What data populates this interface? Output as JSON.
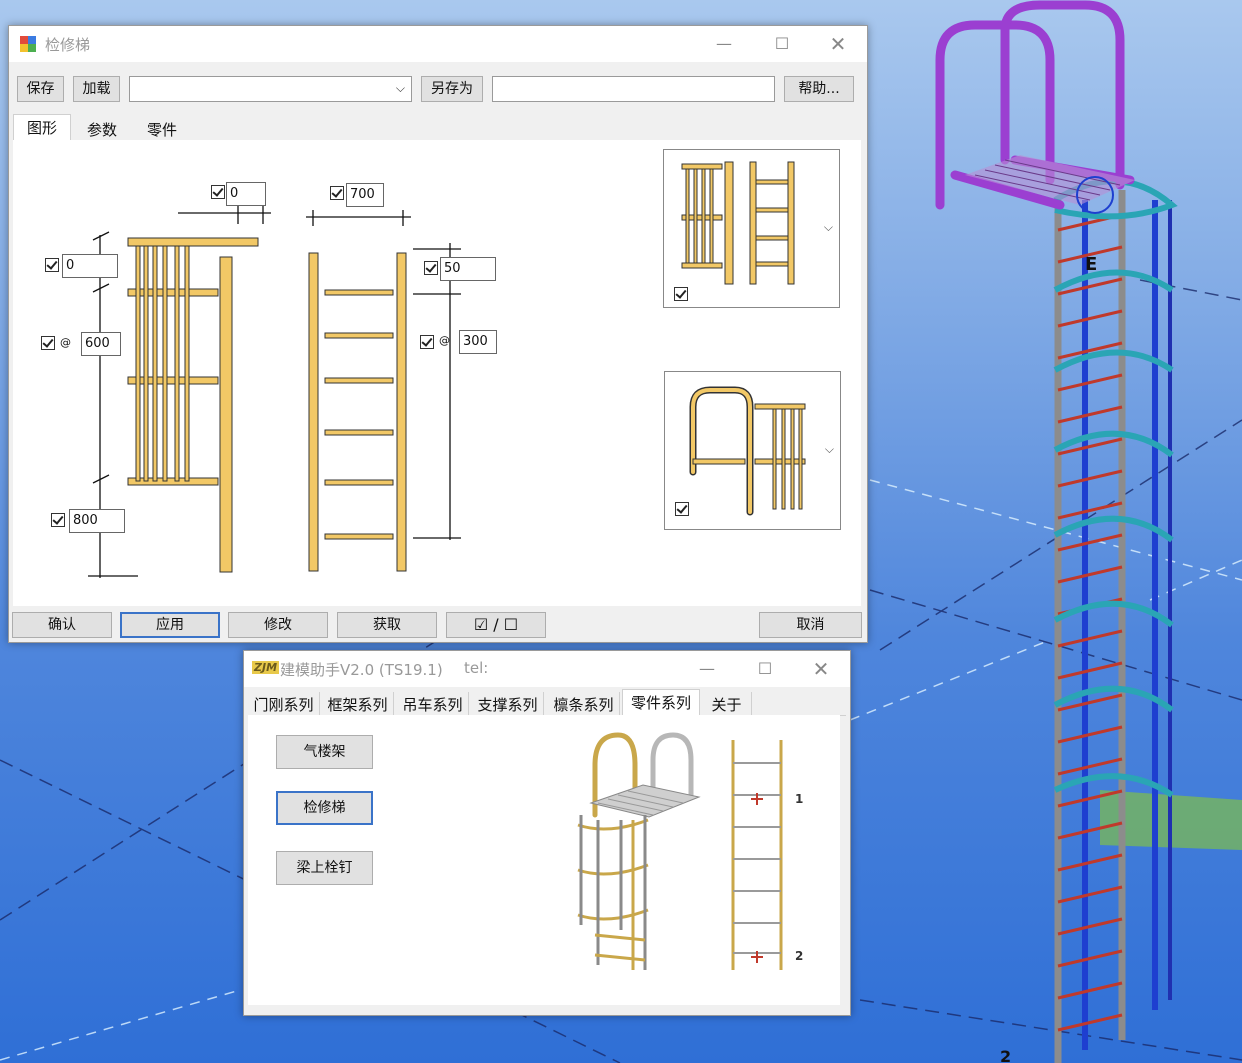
{
  "main_window": {
    "title": "检修梯",
    "toolbar": {
      "save": "保存",
      "load": "加载",
      "preset_value": "",
      "save_as": "另存为",
      "save_as_value": "",
      "help": "帮助..."
    },
    "tabs": [
      "图形",
      "参数",
      "零件"
    ],
    "active_tab": "图形",
    "dims": {
      "top_left": "0",
      "width": "700",
      "left_offset": "0",
      "spacing": "600",
      "bottom": "800",
      "right_offset": "50",
      "rung_spacing": "300",
      "at_symbol": "@"
    },
    "bottom_buttons": {
      "confirm": "确认",
      "apply": "应用",
      "modify": "修改",
      "get": "获取",
      "toggle": "☑ / ☐",
      "cancel": "取消"
    }
  },
  "assistant_window": {
    "title": "建模助手V2.0 (TS19.1)",
    "tel_label": "tel:",
    "logo": "ZJM",
    "tabs": [
      "门刚系列",
      "框架系列",
      "吊车系列",
      "支撑系列",
      "檩条系列",
      "零件系列",
      "关于"
    ],
    "active_tab": "零件系列",
    "buttons": [
      "气楼架",
      "检修梯",
      "梁上栓钉"
    ],
    "point_labels": [
      "1",
      "2"
    ]
  },
  "viewport": {
    "grid_label": "E",
    "bottom_label": "2"
  },
  "colors": {
    "ladder_fill": "#f2c866",
    "rail_purple": "#9b3fd1",
    "cage_teal": "#2aa5b5",
    "rung_red": "#c0392b",
    "pole_blue": "#1e3fd0",
    "pole_gray": "#8c8c8c"
  }
}
